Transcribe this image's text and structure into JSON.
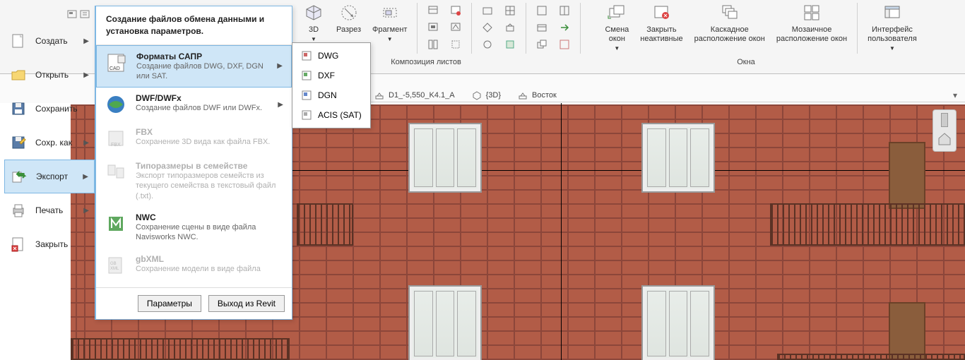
{
  "file_menu": {
    "create": "Создать",
    "open": "Открыть",
    "save": "Сохранить",
    "save_as": "Сохр. как",
    "export": "Экспорт",
    "print": "Печать",
    "close": "Закрыть"
  },
  "export_panel": {
    "header": "Создание файлов обмена данными и установка параметров.",
    "items": {
      "cad": {
        "title": "Форматы САПР",
        "desc": "Создание файлов DWG, DXF, DGN или SAT."
      },
      "dwf": {
        "title": "DWF/DWFx",
        "desc": "Создание файлов DWF или DWFx."
      },
      "fbx": {
        "title": "FBX",
        "desc": "Сохранение 3D вида как файла FBX."
      },
      "fam": {
        "title": "Типоразмеры в семействе",
        "desc": "Экспорт типоразмеров семейств из текущего семейства в текстовый файл (.txt)."
      },
      "nwc": {
        "title": "NWC",
        "desc": "Сохранение сцены в виде файла Navisworks NWC."
      },
      "gbxml": {
        "title": "gbXML",
        "desc": "Сохранение модели в виде файла"
      }
    },
    "options": "Параметры",
    "exit": "Выход из Revit"
  },
  "sub_flyout": {
    "dwg": "DWG",
    "dxf": "DXF",
    "dgn": "DGN",
    "sat": "ACIS (SAT)"
  },
  "ribbon": {
    "three_d": "3D",
    "section": "Разрез",
    "fragment": "Фрагмент",
    "sheet_comp": "Композиция листов",
    "switch_windows": "Смена\nокон",
    "close_inactive": "Закрыть\nнеактивные",
    "cascade": "Каскадное\nрасположение окон",
    "tile": "Мозаичное\nрасположение окон",
    "windows_panel": "Окна",
    "ui": "Интерфейс\nпользователя"
  },
  "view_tabs": {
    "elevation": "D1_-5,550_K4.1_A",
    "three_d": "{3D}",
    "east": "Восток"
  }
}
